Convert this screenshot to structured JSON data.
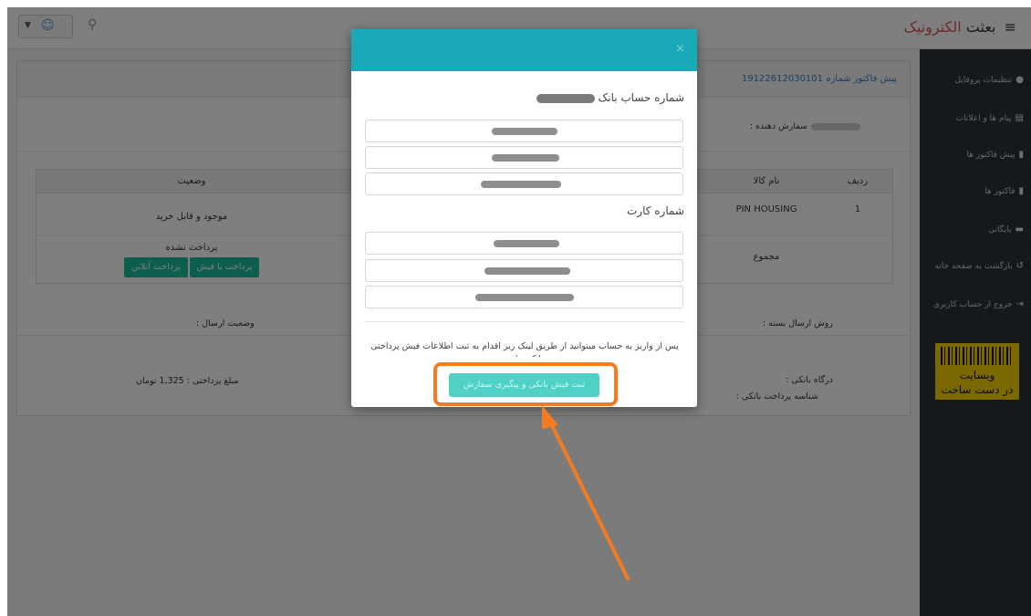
{
  "header": {
    "brand_part1": "بعثت",
    "brand_part2": "الکترونیک",
    "menu_icon": "hamburger-icon"
  },
  "sidebar": {
    "items": [
      {
        "label": "تنظیمات پروفایل",
        "icon": "user-gear-icon"
      },
      {
        "label": "پیام ها و اعلانات",
        "icon": "messages-icon"
      },
      {
        "label": "پیش فاکتور ها",
        "icon": "document-icon"
      },
      {
        "label": "فاکتور ها",
        "icon": "invoice-icon"
      },
      {
        "label": "بایگانی",
        "icon": "archive-icon"
      },
      {
        "label": "بازگشت به صفحه خانه",
        "icon": "back-icon"
      },
      {
        "label": "خروج از حساب کاربری",
        "icon": "logout-icon"
      }
    ],
    "badge": {
      "line1": "وبسایت",
      "line2": "در دست ساخت"
    }
  },
  "panel": {
    "invoice_title": "پیش فاکتور شماره 19122612030101",
    "orderer_label": "سفارش دهنده :",
    "table": {
      "headers": {
        "row": "ردیف",
        "item": "نام کالا",
        "status": "وضعیت"
      },
      "row1": {
        "index": "1",
        "item": "PIN HOUSING",
        "status": "موجود و قابل خرید"
      },
      "total_label": "مجموع",
      "payment_status": "پرداخت نشده",
      "pay_receipt_btn": "پرداخت با فیش",
      "pay_online_btn": "پرداخت آنلاین"
    },
    "shipping_method_label": "روش ارسال بسته :",
    "shipping_status_label": "وضعیت ارسال :",
    "gateway_label": "درگاه بانکی :",
    "bank_payment_id_label": "شناسه پرداخت بانکی :",
    "payment_amount": "مبلغ پرداختی : 1,325 تومان"
  },
  "modal": {
    "close": "×",
    "bank_account_title": "شماره حساب بانک",
    "card_number_title": "شماره کارت",
    "note": "پس از واریز به حساب میتوانید از طریق لینک زیر اقدام به ثبت اطلاعات فیش پرداختی بانک نمایید",
    "submit_button": "ثبت فیش بانکی و پیگیری سفارش"
  },
  "colors": {
    "accent": "#1aa9b8",
    "button": "#4fd1c5",
    "highlight": "#f27c22",
    "sidebar": "#2d3237"
  }
}
